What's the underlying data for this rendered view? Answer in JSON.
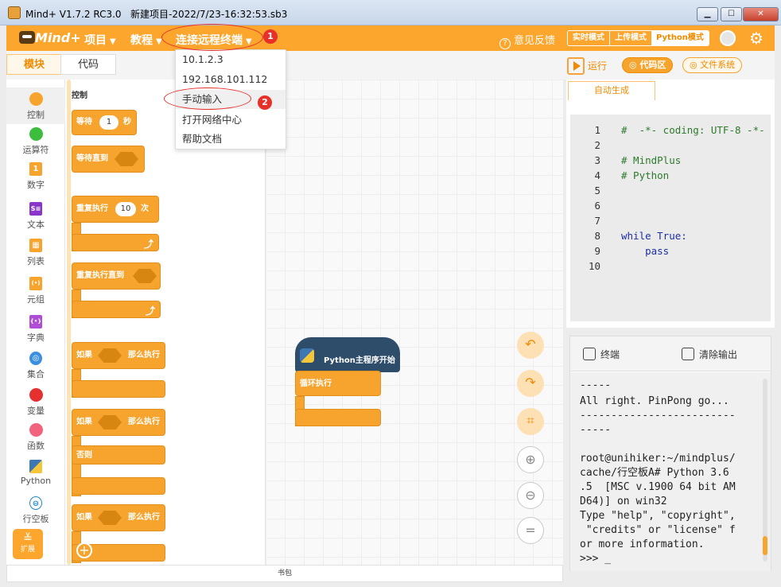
{
  "window": {
    "title": "Mind+ V1.7.2 RC3.0   新建项目-2022/7/23-16:32:53.sb3",
    "buttons": {
      "minimize": "▁",
      "maximize": "☐",
      "close": "✕"
    }
  },
  "topbar": {
    "logo_text": "Mind+",
    "menus": [
      {
        "label": "项目",
        "caret": "▼"
      },
      {
        "label": "教程",
        "caret": "▼"
      },
      {
        "label": "连接远程终端",
        "caret": "▼"
      }
    ],
    "feedback_label": "意见反馈",
    "feedback_icon": "?",
    "modes": {
      "realtime": "实时模式",
      "upload": "上传模式",
      "python": "Python模式"
    },
    "gear_icon": "⚙"
  },
  "tabs": {
    "blocks": "模块",
    "code": "代码"
  },
  "run_label": "运行",
  "code_area_label": "◎ 代码区",
  "file_system_label": "◎ 文件系统",
  "categories": [
    {
      "label": "控制",
      "color": "#f7a42e"
    },
    {
      "label": "运算符",
      "color": "#3dbd3d"
    },
    {
      "label": "数字",
      "color": "#f7a42e",
      "glyph": "1"
    },
    {
      "label": "文本",
      "color": "#8a35c9",
      "glyph": "S≡"
    },
    {
      "label": "列表",
      "color": "#f7a42e",
      "glyph": "▦"
    },
    {
      "label": "元组",
      "color": "#f7a42e",
      "glyph": "(•)"
    },
    {
      "label": "字典",
      "color": "#b04dd6",
      "glyph": "{•}"
    },
    {
      "label": "集合",
      "color": "#3a8fe0",
      "glyph": "◎"
    },
    {
      "label": "变量",
      "color": "#e53030"
    },
    {
      "label": "函数",
      "color": "#f2637e"
    },
    {
      "label": "Python",
      "color": "#3d78b4",
      "glyph": "🐍"
    },
    {
      "label": "行空板",
      "color": "#1e88c8",
      "glyph": "⊖"
    }
  ],
  "extension_label": "扩展",
  "palette": {
    "section": "控制",
    "wait": {
      "label": "等待",
      "value": "1",
      "unit": "秒"
    },
    "wait_until": "等待直到",
    "repeat": {
      "label": "重复执行",
      "value": "10",
      "unit": "次"
    },
    "repeat_until": "重复执行直到",
    "if_then": {
      "if": "如果",
      "then": "那么执行"
    },
    "if_else": {
      "if": "如果",
      "then": "那么执行",
      "else": "否则"
    },
    "if_then2": {
      "if": "如果",
      "then": "那么执行"
    },
    "loop_arrow": "⤴"
  },
  "workspace": {
    "hat_label": "Python主程序开始",
    "loop_label": "循环执行",
    "controls": {
      "undo": "↶",
      "redo": "↷",
      "crop": "⌗",
      "zoom_in": "⊕",
      "zoom_out": "⊖",
      "reset": "="
    }
  },
  "code_panel": {
    "tab": "自动生成",
    "lines": [
      {
        "n": "1",
        "text": "#  -*- coding: UTF-8 -*-"
      },
      {
        "n": "2",
        "text": ""
      },
      {
        "n": "3",
        "text": "# MindPlus"
      },
      {
        "n": "4",
        "text": "# Python"
      },
      {
        "n": "5",
        "text": ""
      },
      {
        "n": "6",
        "text": ""
      },
      {
        "n": "7",
        "text": ""
      },
      {
        "n": "8",
        "text": "while True:"
      },
      {
        "n": "9",
        "text": "    pass"
      },
      {
        "n": "10",
        "text": ""
      }
    ]
  },
  "terminal": {
    "title": "终端",
    "clear_label": "清除输出",
    "lines": [
      "-----",
      "All right. PinPong go...",
      "-------------------------",
      "-----",
      "",
      "root@unihiker:~/mindplus/",
      "cache/行空板A# Python 3.6",
      ".5  [MSC v.1900 64 bit AM",
      "D64)] on win32",
      "Type \"help\", \"copyright\",",
      " \"credits\" or \"license\" f",
      "or more information.",
      ">>> _"
    ]
  },
  "bottom_bar_label": "书包",
  "dropdown": {
    "items": [
      "10.1.2.3",
      "192.168.101.112",
      "手动输入",
      "打开网络中心",
      "帮助文档"
    ]
  },
  "annotations": [
    "1",
    "2"
  ]
}
